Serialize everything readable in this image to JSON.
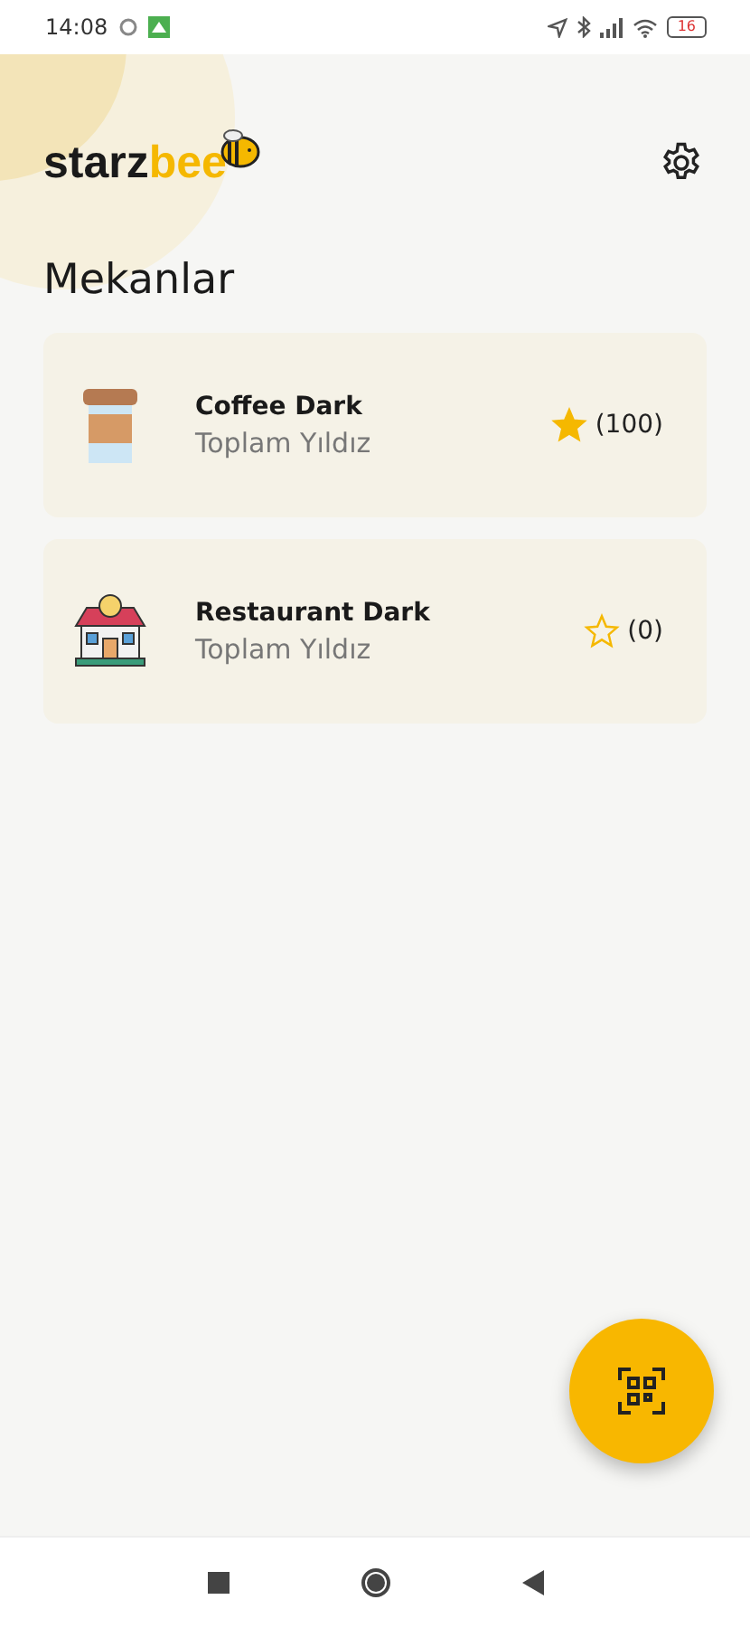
{
  "status_bar": {
    "time": "14:08",
    "battery": "16"
  },
  "logo": {
    "dark": "starz",
    "accent": "bee"
  },
  "title": "Mekanlar",
  "venues": [
    {
      "kind": "coffee",
      "name": "Coffee Dark",
      "subtitle": "Toplam Yıldız",
      "starred": true,
      "count": "(100)"
    },
    {
      "kind": "restaurant",
      "name": "Restaurant Dark",
      "subtitle": "Toplam Yıldız",
      "starred": false,
      "count": "(0)"
    }
  ]
}
